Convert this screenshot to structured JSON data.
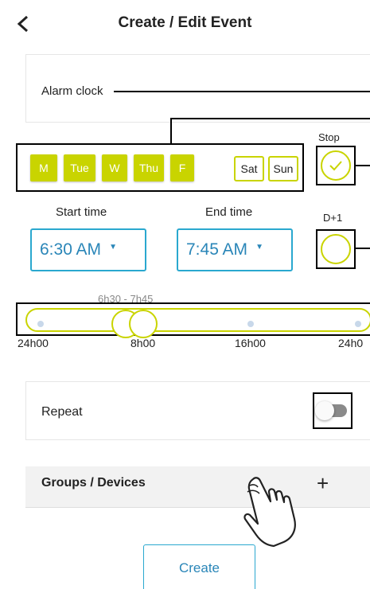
{
  "header": {
    "title": "Create / Edit Event",
    "back_icon": "chevron-left-icon"
  },
  "event": {
    "name": "Alarm clock"
  },
  "days": [
    {
      "label": "M",
      "selected": true
    },
    {
      "label": "Tue",
      "selected": true
    },
    {
      "label": "W",
      "selected": true
    },
    {
      "label": "Thu",
      "selected": true
    },
    {
      "label": "F",
      "selected": true
    },
    {
      "label": "Sat",
      "selected": false
    },
    {
      "label": "Sun",
      "selected": false
    }
  ],
  "stop": {
    "label": "Stop",
    "checked": true
  },
  "next_day": {
    "label": "D+1",
    "checked": false
  },
  "start_time": {
    "label": "Start time",
    "value": "6:30 AM"
  },
  "end_time": {
    "label": "End time",
    "value": "7:45 AM"
  },
  "timeline": {
    "range_label": "6h30 - 7h45",
    "ticks": [
      "24h00",
      "8h00",
      "16h00",
      "24h0"
    ]
  },
  "repeat": {
    "label": "Repeat",
    "enabled": false
  },
  "groups": {
    "label": "Groups / Devices",
    "add_icon": "plus-icon"
  },
  "create_button": {
    "label": "Create"
  },
  "colors": {
    "accent": "#c9d400",
    "link": "#2a86b8",
    "border_blue": "#2aa8cf",
    "annotation": "#000000"
  }
}
